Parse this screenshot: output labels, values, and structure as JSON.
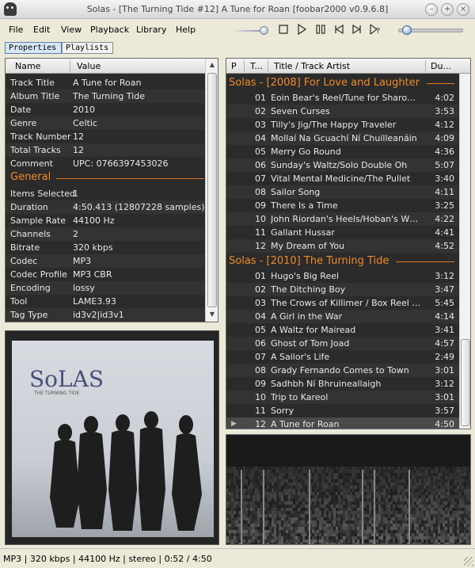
{
  "window": {
    "title": "Solas - [The Turning Tide #12] A Tune for Roan  [foobar2000 v0.9.6.8]"
  },
  "menu": {
    "items": [
      {
        "label": "File"
      },
      {
        "label": "Edit"
      },
      {
        "label": "View"
      },
      {
        "label": "Playback"
      },
      {
        "label": "Library"
      },
      {
        "label": "Help"
      }
    ]
  },
  "transport": {
    "icons": [
      "stop-icon",
      "play-icon",
      "pause-icon",
      "previous-icon",
      "next-icon",
      "random-icon"
    ],
    "volume_level": 0.85,
    "seek_fraction": 0.11
  },
  "tabs": {
    "properties": "Properties",
    "playlists": "Playlists"
  },
  "properties": {
    "col_name": "Name",
    "col_value": "Value",
    "metadata": [
      {
        "k": "Track Title",
        "v": "A Tune for Roan"
      },
      {
        "k": "Album Title",
        "v": "The Turning Tide"
      },
      {
        "k": "Date",
        "v": "2010"
      },
      {
        "k": "Genre",
        "v": "Celtic"
      },
      {
        "k": "Track Number",
        "v": "12"
      },
      {
        "k": "Total Tracks",
        "v": "12"
      },
      {
        "k": "Comment",
        "v": "UPC:  0766397453026"
      }
    ],
    "section_general": "General",
    "general": [
      {
        "k": "Items Selected",
        "v": "1"
      },
      {
        "k": "Duration",
        "v": "4:50.413 (12807228 samples)"
      },
      {
        "k": "Sample Rate",
        "v": "44100 Hz"
      },
      {
        "k": "Channels",
        "v": "2"
      },
      {
        "k": "Bitrate",
        "v": "320 kbps"
      },
      {
        "k": "Codec",
        "v": "MP3"
      },
      {
        "k": "Codec Profile",
        "v": "MP3 CBR"
      },
      {
        "k": "Encoding",
        "v": "lossy"
      },
      {
        "k": "Tool",
        "v": "LAME3.93"
      },
      {
        "k": "Tag Type",
        "v": "id3v2|id3v1"
      }
    ]
  },
  "album_art": {
    "logo": "SoLAS",
    "subtitle": "THE TURNING TIDE"
  },
  "playlist": {
    "col_p": "P",
    "col_t": "T...",
    "col_title": "Title / Track Artist",
    "col_dur": "Du...",
    "groups": [
      {
        "header": "Solas - [2008] For Love and Laughter",
        "tracks": [
          {
            "n": "01",
            "t": "Eoin Bear's Reel/Tune for Sharon/Th...",
            "d": "4:02"
          },
          {
            "n": "02",
            "t": "Seven Curses",
            "d": "3:53"
          },
          {
            "n": "03",
            "t": "Tilly's Jig/The Happy Traveler",
            "d": "4:12"
          },
          {
            "n": "04",
            "t": "Mollaí Na Gcuachí Ní Chuilleanáin",
            "d": "4:09"
          },
          {
            "n": "05",
            "t": "Merry Go Round",
            "d": "4:36"
          },
          {
            "n": "06",
            "t": "Sunday's Waltz/Solo Double Oh",
            "d": "5:07"
          },
          {
            "n": "07",
            "t": "Vital Mental Medicine/The Pullet",
            "d": "3:40"
          },
          {
            "n": "08",
            "t": "Sailor Song",
            "d": "4:11"
          },
          {
            "n": "09",
            "t": "There Is a Time",
            "d": "3:25"
          },
          {
            "n": "10",
            "t": "John Riordan's Heels/Hoban's White ...",
            "d": "4:22"
          },
          {
            "n": "11",
            "t": "Gallant Hussar",
            "d": "4:41"
          },
          {
            "n": "12",
            "t": "My Dream of You",
            "d": "4:52"
          }
        ]
      },
      {
        "header": "Solas - [2010] The Turning Tide",
        "tracks": [
          {
            "n": "01",
            "t": "Hugo's Big Reel",
            "d": "3:12"
          },
          {
            "n": "02",
            "t": "The Ditching Boy",
            "d": "3:47"
          },
          {
            "n": "03",
            "t": "The Crows of Killimer / Box Reel #2 / ...",
            "d": "5:45"
          },
          {
            "n": "04",
            "t": "A Girl in the War",
            "d": "4:14"
          },
          {
            "n": "05",
            "t": "A Waltz for Mairead",
            "d": "3:41"
          },
          {
            "n": "06",
            "t": "Ghost of Tom Joad",
            "d": "4:57"
          },
          {
            "n": "07",
            "t": "A Sailor's Life",
            "d": "2:49"
          },
          {
            "n": "08",
            "t": "Grady Fernando Comes to Town",
            "d": "3:01"
          },
          {
            "n": "09",
            "t": "Sadhbh Ní Bhruineallaigh",
            "d": "3:12"
          },
          {
            "n": "10",
            "t": "Trip to Kareol",
            "d": "3:01"
          },
          {
            "n": "11",
            "t": "Sorry",
            "d": "3:57"
          },
          {
            "n": "12",
            "t": "A Tune for Roan",
            "d": "4:50",
            "playing": true
          }
        ]
      }
    ]
  },
  "status": {
    "text": "MP3 | 320 kbps | 44100 Hz | stereo | 0:52 / 4:50"
  },
  "colors": {
    "panel_bg": "#2b2b2b",
    "accent_orange": "#f08a28",
    "text_light": "#e8e8e8"
  }
}
